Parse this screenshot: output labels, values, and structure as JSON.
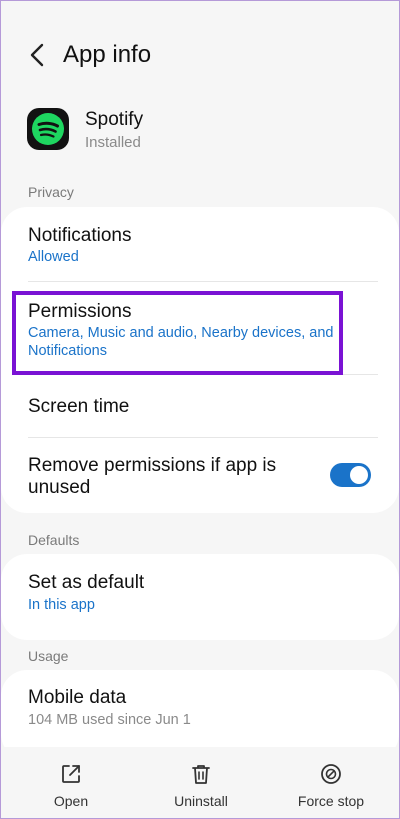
{
  "header": {
    "title": "App info",
    "back_icon": "chevron-left-icon"
  },
  "app": {
    "name": "Spotify",
    "status": "Installed",
    "icon": "spotify-logo-icon",
    "icon_color": "#1ed760"
  },
  "sections": {
    "privacy": "Privacy",
    "defaults": "Defaults",
    "usage": "Usage"
  },
  "privacy_items": {
    "notifications": {
      "title": "Notifications",
      "subtitle": "Allowed"
    },
    "permissions": {
      "title": "Permissions",
      "subtitle_line1": "Camera, Music and audio, Nearby devices, and",
      "subtitle_line2": "Notifications"
    },
    "screen_time": {
      "title": "Screen time"
    },
    "remove_permissions": {
      "title_line1": "Remove permissions if app is",
      "title_line2": "unused",
      "toggle_on": true
    }
  },
  "defaults_items": {
    "set_as_default": {
      "title": "Set as default",
      "subtitle": "In this app"
    }
  },
  "usage_items": {
    "mobile_data": {
      "title": "Mobile data",
      "subtitle": "104 MB used since Jun 1"
    }
  },
  "bottom_bar": {
    "open": {
      "label": "Open",
      "icon": "open-external-icon"
    },
    "uninstall": {
      "label": "Uninstall",
      "icon": "trash-icon"
    },
    "force_stop": {
      "label": "Force stop",
      "icon": "block-icon"
    }
  },
  "colors": {
    "accent": "#1a73c9",
    "highlight": "#7a12d4",
    "background": "#f6f6f6",
    "card": "#ffffff"
  }
}
